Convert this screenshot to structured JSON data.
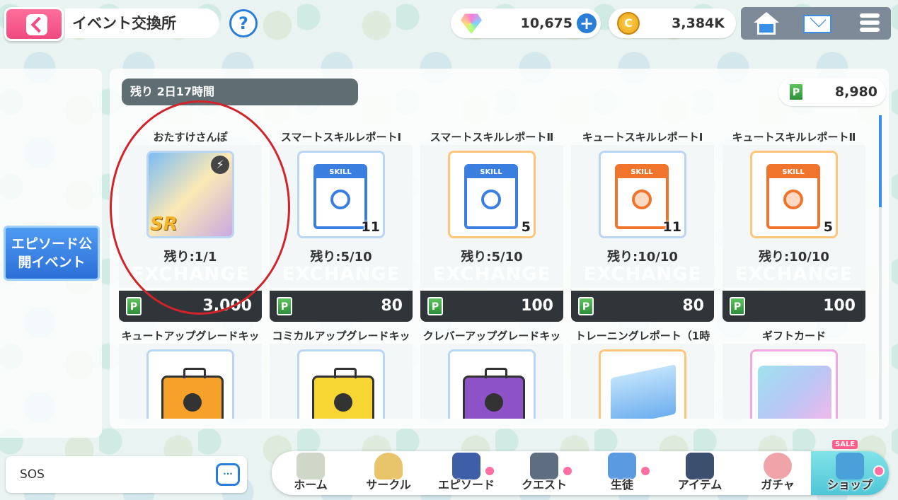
{
  "header": {
    "title": "イベント交換所",
    "help": "?",
    "gems": "10,675",
    "coins": "3,384K",
    "coin_symbol": "C"
  },
  "side": {
    "event_tab": [
      "エピソード公",
      "開イベント"
    ]
  },
  "main": {
    "timer": "残り 2日17時間",
    "points": "8,980",
    "point_symbol": "P"
  },
  "items": [
    {
      "name": "おたすけさんぽ",
      "remain": "残り:1/1",
      "price": "3,000",
      "qty": "",
      "watermark": "EXCHANGE",
      "badge": "SR",
      "art": "sr-card"
    },
    {
      "name": "スマートスキルレポートⅠ",
      "remain": "残り:5/10",
      "price": "80",
      "qty": "11",
      "watermark": "EXCHANGE",
      "art": "skill-blue"
    },
    {
      "name": "スマートスキルレポートⅡ",
      "remain": "残り:5/10",
      "price": "100",
      "qty": "5",
      "watermark": "EXCHANGE",
      "art": "skill-blue-2"
    },
    {
      "name": "キュートスキルレポートⅠ",
      "remain": "残り:10/10",
      "price": "80",
      "qty": "11",
      "watermark": "EXCHANGE",
      "art": "skill-orange"
    },
    {
      "name": "キュートスキルレポートⅡ",
      "remain": "残り:10/10",
      "price": "100",
      "qty": "5",
      "watermark": "EXCHANGE",
      "art": "skill-orange-2"
    },
    {
      "name": "キュートアップグレードキッ",
      "art": "box-orange"
    },
    {
      "name": "コミカルアップグレードキッ",
      "art": "box-yellow"
    },
    {
      "name": "クレバーアップグレードキッ",
      "art": "box-purple"
    },
    {
      "name": "トレーニングレポート（1時",
      "art": "tickets"
    },
    {
      "name": "ギフトカード",
      "art": "gift-card"
    }
  ],
  "chat": {
    "label": "SOS",
    "icon_text": "···"
  },
  "nav": [
    {
      "label": "ホーム",
      "icon": "school-icon"
    },
    {
      "label": "サークル",
      "icon": "crest-icon"
    },
    {
      "label": "エピソード",
      "icon": "book-icon"
    },
    {
      "label": "クエスト",
      "icon": "gun-icon"
    },
    {
      "label": "生徒",
      "icon": "id-card-icon"
    },
    {
      "label": "アイテム",
      "icon": "bag-icon"
    },
    {
      "label": "ガチャ",
      "icon": "gacha-icon"
    },
    {
      "label": "ショップ",
      "icon": "cart-icon",
      "badge": "SALE"
    }
  ],
  "colors": {
    "accent": "#2b7ed8",
    "back": "#f04a80",
    "price_bar": "#2f3538",
    "selection": "#d2232a"
  }
}
